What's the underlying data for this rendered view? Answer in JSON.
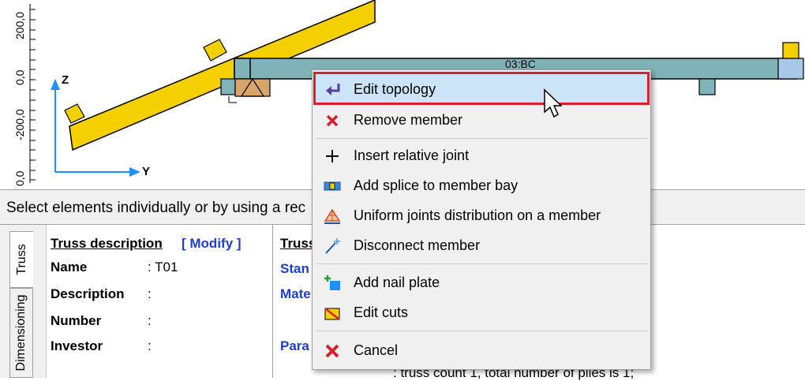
{
  "canvas": {
    "ruler_labels": [
      "200,0",
      "0,0",
      "-200,0",
      "0,0"
    ],
    "axis_z": "Z",
    "axis_y": "Y",
    "member_label": "03:BC"
  },
  "status": {
    "text": "Select elements individually or by  using a rec"
  },
  "tabs": {
    "truss": "Truss",
    "dimensioning": "Dimensioning"
  },
  "truss_description": {
    "header": "Truss description",
    "modify": "[ Modify ]",
    "rows": [
      {
        "label": "Name",
        "value": ": T01"
      },
      {
        "label": "Description",
        "value": ":"
      },
      {
        "label": "Number",
        "value": ":"
      },
      {
        "label": "Investor",
        "value": ":"
      }
    ]
  },
  "right_panel": {
    "header": "Truss",
    "standard": "Stan",
    "material": "Mate",
    "parameters": "Para",
    "footer_text": ": truss count 1, total number of plies is 1;"
  },
  "context_menu": {
    "items": [
      {
        "label": "Edit topology",
        "icon": "arrow-return-icon"
      },
      {
        "label": "Remove member",
        "icon": "red-x-icon"
      },
      {
        "label": "Insert relative joint",
        "icon": "plus-icon"
      },
      {
        "label": "Add splice to member bay",
        "icon": "splice-icon"
      },
      {
        "label": "Uniform joints distribution on a member",
        "icon": "joints-distribution-icon"
      },
      {
        "label": "Disconnect member",
        "icon": "disconnect-wand-icon"
      },
      {
        "label": "Add nail plate",
        "icon": "nail-plate-icon"
      },
      {
        "label": "Edit cuts",
        "icon": "edit-cuts-icon"
      },
      {
        "label": "Cancel",
        "icon": "red-x-icon"
      }
    ]
  },
  "colors": {
    "rafter": "#f5d000",
    "beam": "#7fb3b8",
    "highlight_border": "#d6202e",
    "selected_bg": "#cce4f7",
    "link_blue": "#1f3fc8"
  }
}
